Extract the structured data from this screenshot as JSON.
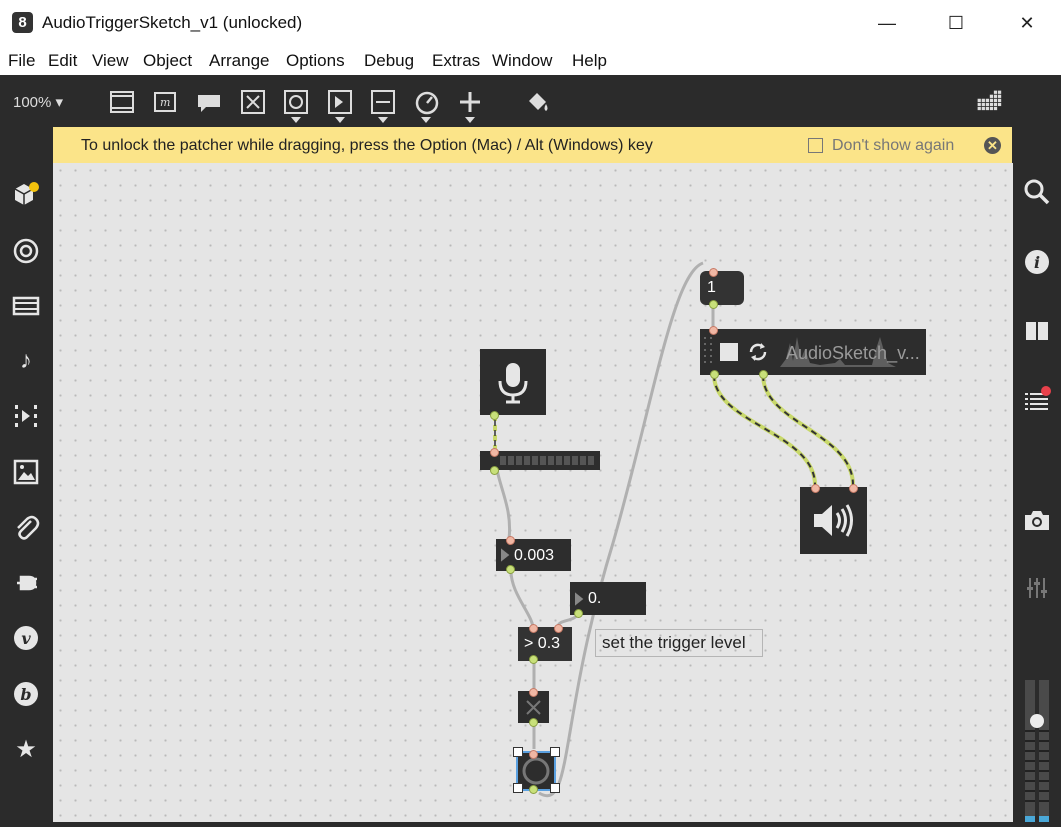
{
  "window": {
    "title": "AudioTriggerSketch_v1 (unlocked)",
    "minimize": "—",
    "maximize": "☐",
    "close": "✕"
  },
  "menu": [
    "File",
    "Edit",
    "View",
    "Object",
    "Arrange",
    "Options",
    "Debug",
    "Extras",
    "Window",
    "Help"
  ],
  "toolbar": {
    "zoom": "100% ▾"
  },
  "banner": {
    "text": "To unlock the patcher while dragging, press the Option (Mac) / Alt (Windows) key",
    "checkbox_label": "Don't show again",
    "close": "✕"
  },
  "patch": {
    "message_box": "1",
    "number_box_a": "0.003",
    "number_box_b": "0.",
    "compare_object": "> 0.3",
    "comment": "set the trigger level",
    "playlist_name": "AudioSketch_v..."
  },
  "colors": {
    "accent": "#fbe489",
    "patch_cord": "#b0b0b0",
    "signal_cord": "#c8d86a",
    "object_bg": "#2d2d2d"
  }
}
